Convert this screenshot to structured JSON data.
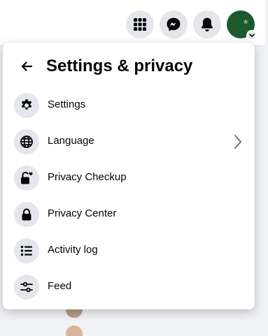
{
  "topbar": {
    "menu_icon": "grid-menu-icon",
    "messenger_icon": "messenger-icon",
    "notifications_icon": "bell-icon",
    "account_icon": "profile-avatar",
    "account_badge_icon": "chevron-down-icon"
  },
  "panel": {
    "back_icon": "arrow-left-icon",
    "title": "Settings & privacy",
    "items": [
      {
        "label": "Settings",
        "icon": "gear-icon"
      },
      {
        "label": "Language",
        "icon": "globe-icon",
        "has_submenu": true
      },
      {
        "label": "Privacy Checkup",
        "icon": "lock-heart-icon"
      },
      {
        "label": "Privacy Center",
        "icon": "lock-icon"
      },
      {
        "label": "Activity log",
        "icon": "list-icon"
      },
      {
        "label": "Feed",
        "icon": "sliders-icon"
      }
    ]
  },
  "colors": {
    "icon_bg": "#e4e6eb",
    "text": "#050505",
    "page_bg": "#f0f2f5",
    "avatar_bg": "#1c5a2e"
  }
}
